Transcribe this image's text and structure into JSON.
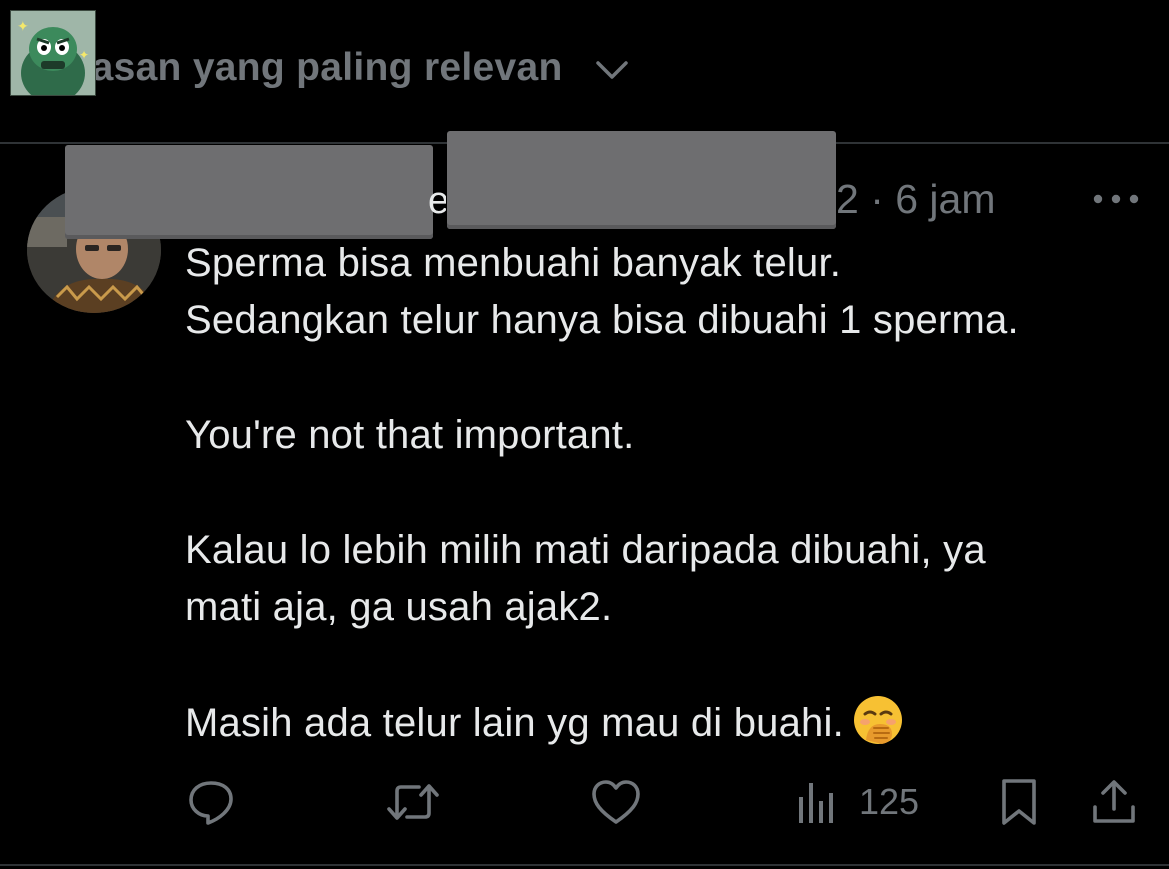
{
  "header": {
    "sort_label": "Balasan yang paling relevan",
    "sort_icon": "chevron-down-icon"
  },
  "post": {
    "name_fragment": "e",
    "meta": "2 · 6 jam",
    "more_icon": "more-horizontal-icon",
    "lines": [
      "Sperma bisa menbuahi banyak telur.",
      "Sedangkan telur hanya bisa dibuahi 1 sperma.",
      "You're not that important.",
      "Kalau lo lebih milih mati daripada dibuahi, ya",
      "mati aja, ga usah ajak2.",
      "Masih ada telur lain yg mau di buahi."
    ],
    "emoji": "hand-over-mouth-emoji"
  },
  "actions": {
    "reply_icon": "reply-icon",
    "repost_icon": "repost-icon",
    "like_icon": "heart-icon",
    "views_icon": "views-icon",
    "views_count": "125",
    "bookmark_icon": "bookmark-icon",
    "share_icon": "share-icon"
  },
  "colors": {
    "background": "#000000",
    "text_primary": "#e7e9ea",
    "text_secondary": "#71767b",
    "divider": "#2f3336",
    "redaction": "#6e6e70"
  }
}
